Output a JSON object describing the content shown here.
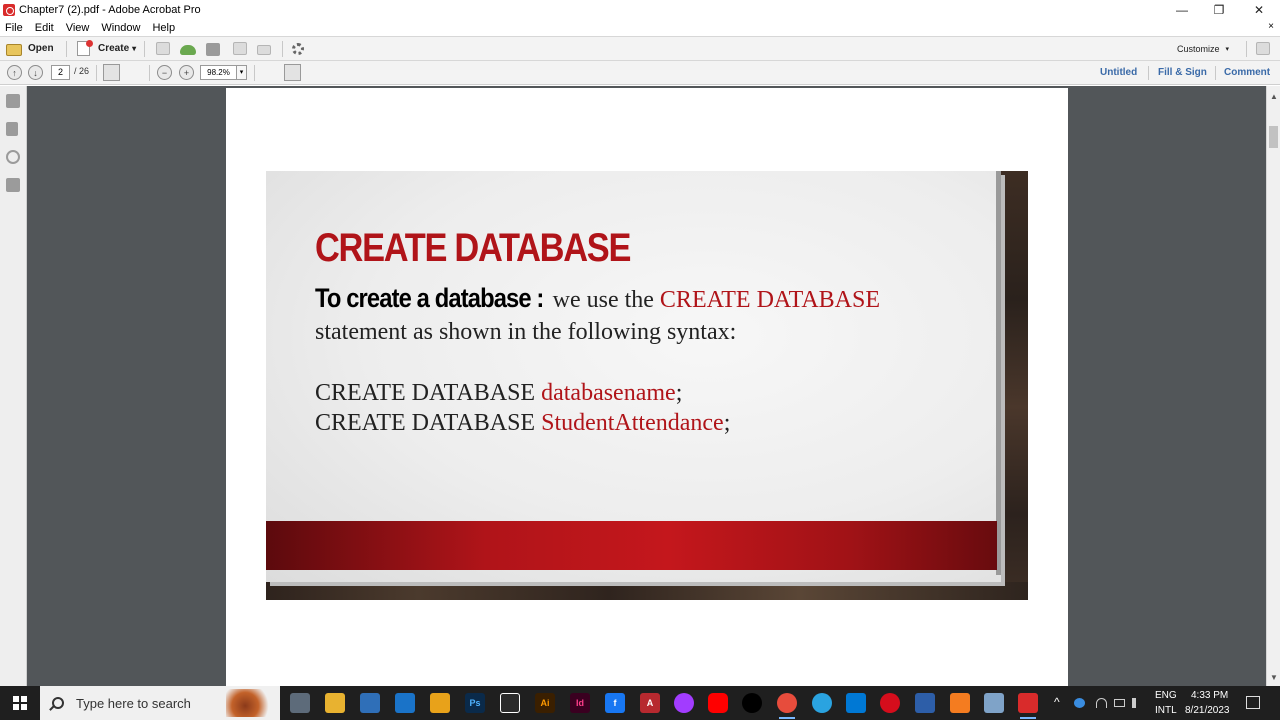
{
  "window": {
    "title": "Chapter7 (2).pdf - Adobe Acrobat Pro",
    "minimize": "—",
    "restore": "❐",
    "close": "✕"
  },
  "menu": {
    "items": [
      "File",
      "Edit",
      "View",
      "Window",
      "Help"
    ],
    "close_doc": "×"
  },
  "toolbar": {
    "open_label": "Open",
    "create_label": "Create",
    "customize_label": "Customize",
    "dropdown_glyph": "▾"
  },
  "navbar": {
    "page_current": "2",
    "page_total": "/ 26",
    "zoom": "98.2%",
    "zoom_out": "−",
    "zoom_in": "+",
    "prev": "↑",
    "next": "↓",
    "links": [
      "Untitled",
      "Fill & Sign",
      "Comment"
    ]
  },
  "slide": {
    "title": "CREATE DATABASE",
    "lead": "To create a database :",
    "line1_text": "we use the ",
    "line1_red": "CREATE DATABASE",
    "line2_text": "statement as shown in the following syntax:",
    "syntax1_text": "CREATE DATABASE ",
    "syntax1_red": "databasename",
    "syntax1_end": ";",
    "syntax2_text": "CREATE DATABASE ",
    "syntax2_red": "StudentAttendance",
    "syntax2_end": ";"
  },
  "scrollbar": {
    "up": "▲",
    "down": "▼"
  },
  "taskbar": {
    "search_placeholder": "Type here to search",
    "lang_top": "ENG",
    "lang_bottom": "INTL",
    "time": "4:33 PM",
    "date": "8/21/2023",
    "tray_chevron": "^"
  },
  "colors": {
    "accent_red": "#b01419",
    "link_blue": "#3a6aa8",
    "doc_bg": "#525659"
  }
}
